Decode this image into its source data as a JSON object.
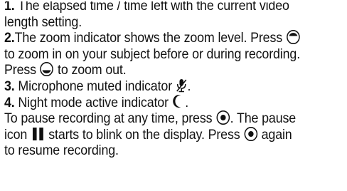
{
  "items": [
    {
      "number": "1.",
      "text_a": " The elapsed time / time left with the current video",
      "text_b": "length setting."
    },
    {
      "number": "2.",
      "text_a": "The zoom indicator shows the zoom level. Press ",
      "text_b": "to zoom in on your subject before or during recording.",
      "text_c_before": "Press ",
      "text_c_after": " to zoom out.",
      "icon_in": "scroll-up-key-icon",
      "icon_out": "scroll-down-key-icon"
    },
    {
      "number": "3.",
      "text_before": " Microphone muted indicator ",
      "text_after": ".",
      "icon": "muted-microphone-icon"
    },
    {
      "number": "4.",
      "text_before": " Night mode active indicator ",
      "text_after": ".",
      "icon": "night-mode-moon-icon"
    }
  ],
  "pause_para": {
    "line1_before": "To pause recording at any time, press ",
    "line1_after": ". The pause",
    "line2_before": "icon ",
    "line2_mid": " starts to blink on the display. Press ",
    "line2_after": " again",
    "line3": "to resume recording.",
    "key_icon": "select-key-icon",
    "pause_icon": "pause-icon"
  }
}
